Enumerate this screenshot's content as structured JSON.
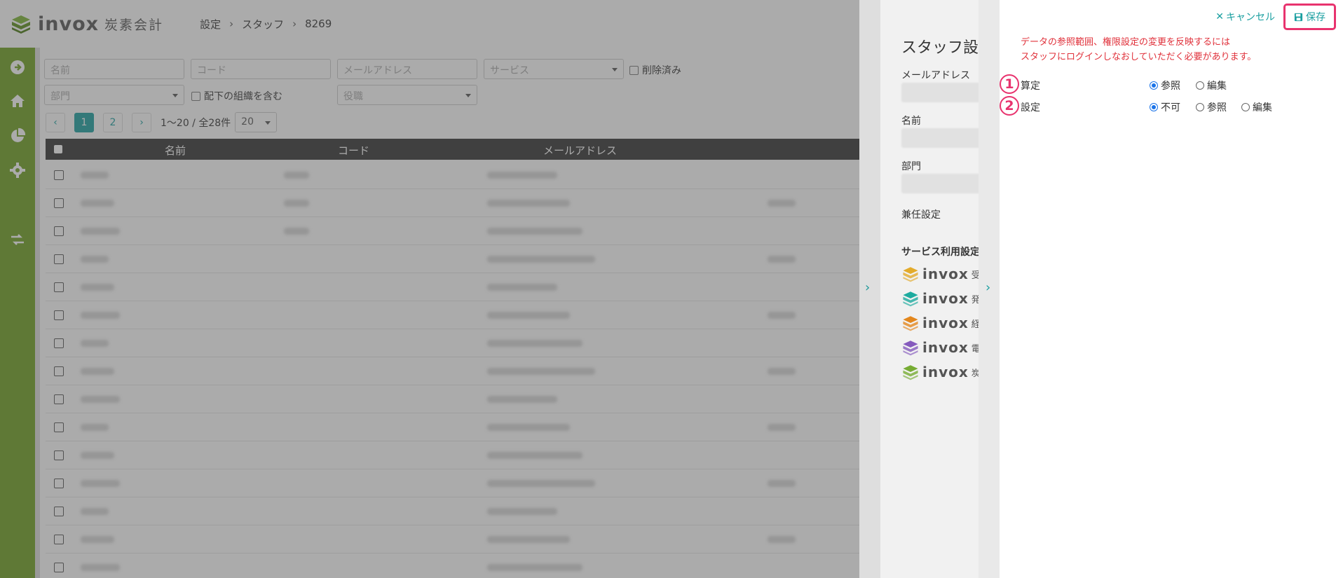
{
  "brand": {
    "logo_text": "invox",
    "logo_sub": "炭素会計",
    "accent": "#6ea01f",
    "teal": "#1a9fa0"
  },
  "breadcrumb": [
    "設定",
    "スタッフ",
    "8269"
  ],
  "filters": {
    "name_placeholder": "名前",
    "code_placeholder": "コード",
    "email_placeholder": "メールアドレス",
    "service_placeholder": "サービス",
    "deleted_label": "削除済み",
    "department_placeholder": "部門",
    "include_sub_label": "配下の組織を含む",
    "position_placeholder": "役職"
  },
  "pagination": {
    "pages": [
      "1",
      "2"
    ],
    "current": "1",
    "info": "1〜20 / 全28件",
    "page_size": "20"
  },
  "table": {
    "columns": [
      "名前",
      "コード",
      "メールアドレス"
    ]
  },
  "staff_drawer": {
    "title": "スタッフ設定",
    "email_label": "メールアドレス",
    "name_label": "名前",
    "department_label": "部門",
    "concurrent_label": "兼任設定",
    "service_section": "サービス利用設定",
    "services": [
      {
        "text": "invox",
        "sub": "受",
        "color": "#f0b429",
        "icon": "invox-receive-logo"
      },
      {
        "text": "invox",
        "sub": "発",
        "color": "#1ab3a6",
        "icon": "invox-issue-logo"
      },
      {
        "text": "invox",
        "sub": "経",
        "color": "#f08c1a",
        "icon": "invox-expense-logo"
      },
      {
        "text": "invox",
        "sub": "電",
        "color": "#8a5cc7",
        "icon": "invox-denshi-logo"
      },
      {
        "text": "invox",
        "sub": "炭",
        "color": "#7bb532",
        "icon": "invox-carbon-logo"
      }
    ]
  },
  "permission_drawer": {
    "cancel_label": "キャンセル",
    "save_label": "保存",
    "notice_line1": "データの参照範囲、権限設定の変更を反映するには",
    "notice_line2": "スタッフにログインしなおしていただく必要があります。",
    "rows": [
      {
        "badge": "1",
        "label": "算定",
        "options": [
          "参照",
          "編集"
        ],
        "selected": "参照"
      },
      {
        "badge": "2",
        "label": "設定",
        "options": [
          "不可",
          "参照",
          "編集"
        ],
        "selected": "不可"
      }
    ]
  }
}
